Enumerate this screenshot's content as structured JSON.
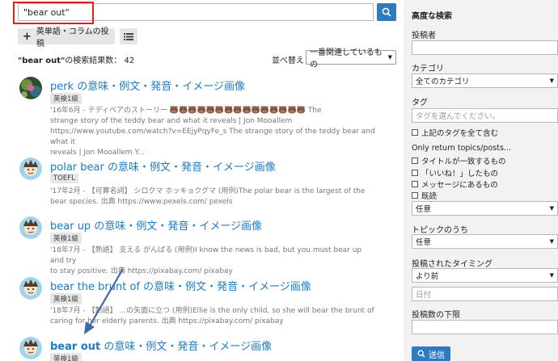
{
  "search": {
    "value": "\"bear out\""
  },
  "toolbar": {
    "post_label": "英単語・コラムの投稿"
  },
  "results_header": {
    "query": "\"bear out\"",
    "count_text": "の検索結果数： 42",
    "sort_label": "並べ替え",
    "sort_value": "一番関連しているもの"
  },
  "results": [
    {
      "title_kw": "perk",
      "title_rest": " の意味・例文・発音・イメージ画像",
      "badge": "英検1級",
      "line1_prefix": "'16年6月 - テディベアのストーリー ",
      "line1_emojis": "🐻🐻🐻🐻🐻🐻🐻🐻🐻🐻🐻🐻🐻🐻🐻",
      "line1_suffix": " The",
      "lines": [
        "strange story of the teddy bear and what it reveals | Jon Mooallem",
        "https://www.youtube.com/watch?v=EEjyPqyFe_s The strange story of the teddy bear and what it",
        "reveals | Jon Mooallem Y..."
      ]
    },
    {
      "title_kw": "polar bear",
      "title_rest": " の意味・例文・発音・イメージ画像",
      "badge": "TOEFL",
      "lines": [
        "'17年2月 - 【可算名詞】 シロクマ ホッキョクグマ (用例)The polar bear is the largest of the",
        "bear species. 出典 https://www.pexels.com/ pexels"
      ]
    },
    {
      "title_kw": "bear up",
      "title_rest": " の意味・例文・発音・イメージ画像",
      "badge": "英検1級",
      "lines": [
        "'18年7月 - 【熟語】 支える がんばる (用例)I know the news is bad, but you must bear up and try",
        "to stay positive. 出典 https://pixabay.com/ pixabay"
      ]
    },
    {
      "title_kw": "bear the brunt of",
      "title_rest": " の意味・例文・発音・イメージ画像",
      "badge": "英検1級",
      "lines": [
        "'18年7月 - 【熟語】 ...の矢面に立つ (用例)Ellie is the only child, so she will bear the brunt of",
        "caring for her elderly parents. 出典 https://pixabay.com/ pixabay"
      ]
    },
    {
      "title_kw": "bear out",
      "title_rest": " の意味・例文・発音・イメージ画像",
      "badge": "英検1級",
      "lines": []
    }
  ],
  "sidebar": {
    "title": "高度な検索",
    "poster_label": "投稿者",
    "category_label": "カテゴリ",
    "category_value": "全てのカテゴリ",
    "tag_label": "タグ",
    "tag_placeholder": "タグを選んでください。",
    "tag_all_label": "上記のタグを全て含む",
    "only_return_label": "Only return topics/posts...",
    "checks": [
      "タイトルが一致するもの",
      "「いいね！」したもの",
      "メッセージにあるもの",
      "既読"
    ],
    "any1": "任意",
    "topic_label": "トピックのうち",
    "any2": "任意",
    "timing_label": "投稿されたタイミング",
    "timing_value": "より前",
    "date_placeholder": "日付",
    "min_posts_label": "投稿数の下限",
    "send_label": "送信"
  },
  "colors": {
    "accent": "#2f7bbf",
    "link": "#1a7bc4",
    "highlight": "#e01e1e",
    "arrow": "#3d6aa8"
  }
}
